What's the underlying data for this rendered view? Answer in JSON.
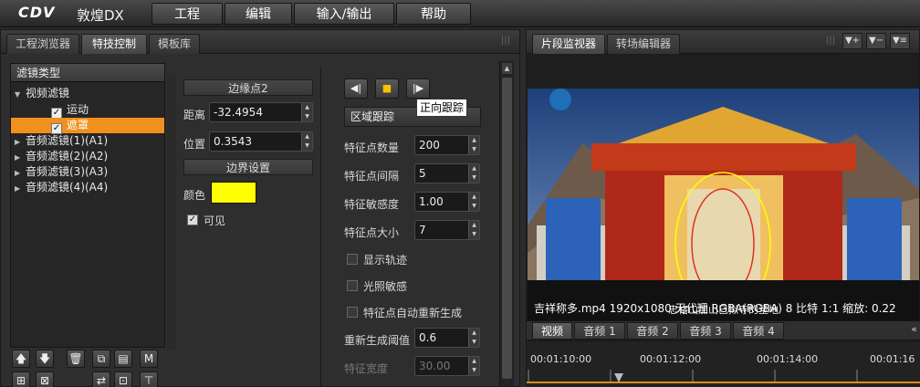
{
  "app": {
    "logo": "CDV",
    "name": "敦煌DX"
  },
  "menu": [
    "工程",
    "编辑",
    "输入/输出",
    "帮助"
  ],
  "left_tabs": [
    "工程浏览器",
    "特技控制",
    "模板库"
  ],
  "tree": {
    "header": "滤镜类型",
    "items": [
      "视频滤镜",
      "运动",
      "遮罩",
      "音频滤镜(1)(A1)",
      "音频滤镜(2)(A2)",
      "音频滤镜(3)(A3)",
      "音频滤镜(4)(A4)"
    ]
  },
  "edge": {
    "header": "边缘点2",
    "distance_label": "距离",
    "distance_value": "-32.4954",
    "position_label": "位置",
    "position_value": "0.3543",
    "border_header": "边界设置",
    "color_label": "颜色",
    "color": "#ffff00",
    "visible_label": "可见"
  },
  "tracking": {
    "mode": "区域跟踪",
    "tooltip": "正向跟踪",
    "count_label": "特征点数量",
    "count_value": "200",
    "spacing_label": "特征点间隔",
    "spacing_value": "5",
    "sensitivity_label": "特征敏感度",
    "sensitivity_value": "1.00",
    "size_label": "特征点大小",
    "size_value": "7",
    "show_track": "显示轨迹",
    "light_sensitive": "光照敏感",
    "auto_regen": "特征点自动重新生成",
    "regen_label": "重新生成阈值",
    "regen_value": "0.6",
    "width_label": "特征宽度",
    "width_value": "30.00"
  },
  "right_tabs": [
    "片段监视器",
    "转场编辑器"
  ],
  "preview": {
    "info": "吉祥称多.mp4 1920x1080 无代理 RGBA(RGBA)  8 比特  1:1  缩放: 0.22",
    "caption": "忠格山加山巳拟寺的圣地"
  },
  "track_tabs": [
    "视频",
    "音频 1",
    "音频 2",
    "音频 3",
    "音频 4"
  ],
  "timecodes": [
    "00:01:10:00",
    "00:01:12:00",
    "00:01:14:00",
    "00:01:16"
  ]
}
